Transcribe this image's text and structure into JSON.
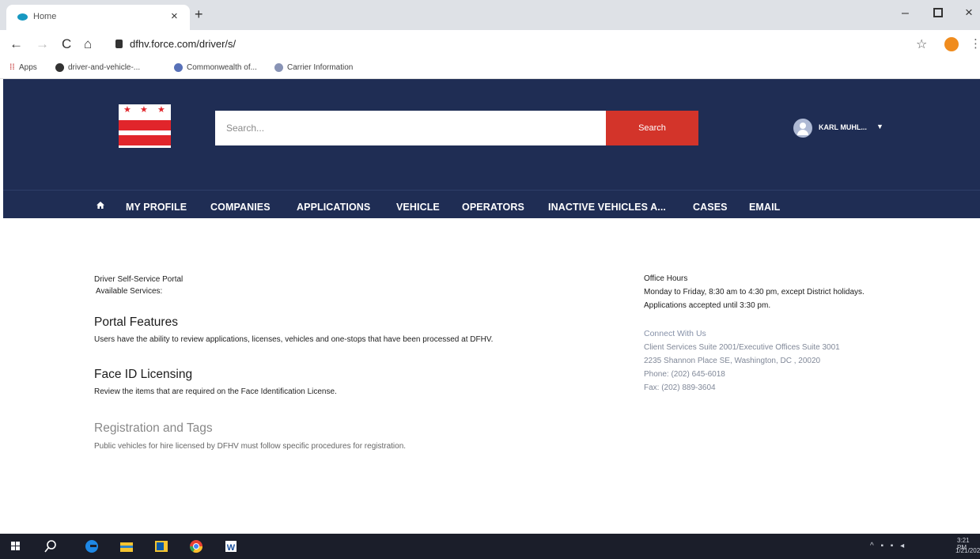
{
  "browser": {
    "tab_title": "Home",
    "tab_close": "×",
    "new_tab": "+",
    "url": "dfhv.force.com/driver/s/",
    "bookmarks": [
      "Apps",
      "driver-and-vehicle-...",
      "Commonwealth of...",
      "Carrier Information"
    ]
  },
  "header": {
    "search_placeholder": "Search...",
    "search_button": "Search",
    "user_name": "KARL MUHL..."
  },
  "nav": {
    "items": [
      "MY PROFILE",
      "COMPANIES",
      "APPLICATIONS",
      "VEHICLE",
      "OPERATORS",
      "INACTIVE VEHICLES A...",
      "CASES",
      "EMAIL"
    ]
  },
  "main": {
    "portal_title": "Driver Self-Service Portal",
    "available_services": "Available Services:",
    "sections": [
      {
        "title": "Portal Features",
        "description": "Users have the ability to review applications, licenses, vehicles and one-stops that have been processed at DFHV."
      },
      {
        "title": "Face ID Licensing",
        "description": "Review the items that are required on the Face Identification License."
      },
      {
        "title": "Registration and Tags",
        "description": "Public vehicles for hire licensed by DFHV must follow specific procedures for registration."
      }
    ]
  },
  "sidebar": {
    "office_hours_title": "Office Hours",
    "office_hours_line1": "Monday to Friday, 8:30 am to 4:30 pm, except District holidays.",
    "office_hours_line2": "Applications accepted until 3:30 pm.",
    "connect_title": "Connect With Us",
    "connect_lines": [
      "Client Services Suite 2001/Executive Offices Suite 3001",
      "2235 Shannon Place SE, Washington, DC , 20020",
      "Phone: (202) 645-6018",
      "Fax: (202) 889-3604"
    ]
  },
  "taskbar": {
    "clock_time": "3:21 PM",
    "clock_date": "1/21/202"
  },
  "colors": {
    "header_bg": "#1f2d54",
    "search_button": "#d3342a",
    "flag_red": "#e1252b"
  },
  "icons": [
    "home-icon",
    "lock-icon",
    "star-icon",
    "user-avatar-icon",
    "caret-down-icon",
    "windows-start-icon",
    "search-icon",
    "edge-icon",
    "file-explorer-icon",
    "outlook-icon",
    "chrome-icon",
    "word-icon"
  ]
}
